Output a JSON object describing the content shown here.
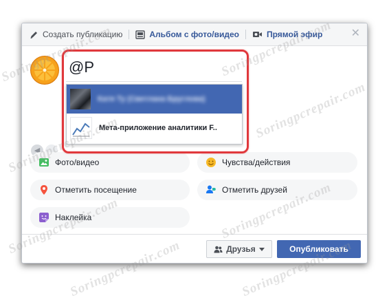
{
  "header": {
    "create_post": "Создать публикацию",
    "photo_album": "Альбом с фото/видео",
    "live_video": "Прямой эфир",
    "close_symbol": "✕"
  },
  "mention": {
    "query": "@P",
    "suggestions": [
      {
        "name": "Катя Ту (Светлана Бруглова)",
        "highlighted": true,
        "blurred": true,
        "thumb": "profile-photo"
      },
      {
        "name": "Мета-приложение аналитики F..",
        "highlighted": false,
        "blurred": false,
        "thumb": "analytics-chart-icon"
      }
    ]
  },
  "options": {
    "photo_video": "Фото/видео",
    "feelings": "Чувства/действия",
    "check_in": "Отметить посещение",
    "tag_friends": "Отметить друзей",
    "sticker": "Наклейка"
  },
  "footer": {
    "audience": "Друзья",
    "publish": "Опубликовать"
  },
  "watermark": "Soringpcrepair.com",
  "colors": {
    "brand_blue": "#4267b2",
    "link_blue": "#365899",
    "highlight_red": "#e0383c",
    "pill_bg": "#f5f6f7"
  }
}
